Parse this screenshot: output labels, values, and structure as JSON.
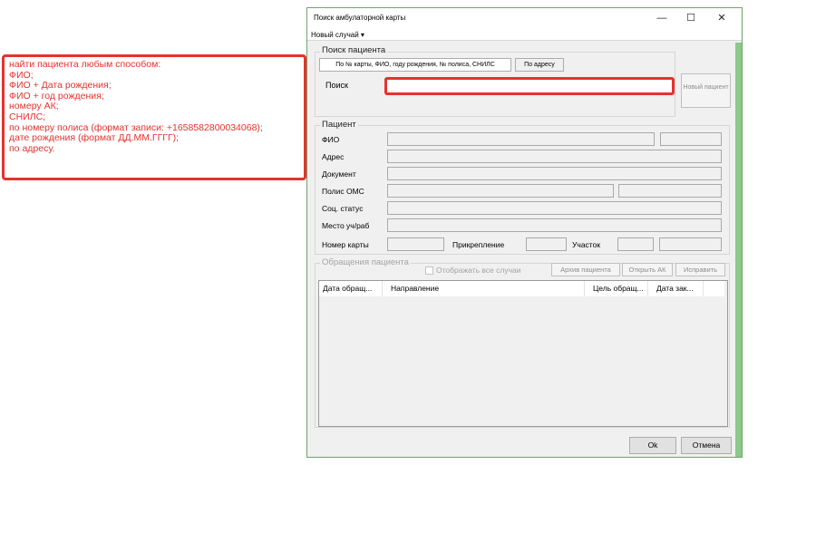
{
  "annotation": {
    "lines": [
      "найти пациента любым способом:",
      "ФИО;",
      "ФИО + Дата рождения;",
      "ФИО + год рождения;",
      "номеру АК;",
      "СНИЛС;",
      "по номеру полиса (формат записи: +1658582800034068);",
      "дате рождения (формат ДД.ММ.ГГГГ);",
      "по адресу."
    ],
    "color": "#e5322d"
  },
  "window": {
    "title": "Поиск амбулаторной карты",
    "controls": {
      "minimize": "—",
      "maximize": "☐",
      "close": "✕"
    },
    "menu": {
      "new_case": "Новый случай ▾"
    }
  },
  "search_group": {
    "label": "Поиск пациента",
    "tabs": [
      "По № карты, ФИО, году рождения, № полиса, СНИЛС",
      "По адресу"
    ],
    "search_label": "Поиск",
    "search_value": "",
    "new_patient_button": "Новый пациент"
  },
  "patient_group": {
    "label": "Пациент",
    "fields": {
      "fio": "ФИО",
      "address": "Адрес",
      "document": "Документ",
      "oms": "Полис ОМС",
      "social_status": "Соц. статус",
      "workplace": "Место уч/раб",
      "card_number": "Номер карты",
      "attachment": "Прикрепление",
      "district": "Участок"
    }
  },
  "visits_group": {
    "label": "Обращения пациента",
    "show_all_label": "Отображать все случаи",
    "buttons": {
      "archive": "Архив пациента",
      "open": "Открыть АК",
      "fix": "Исправить"
    },
    "columns": [
      "Дата обращ...",
      "Направление",
      "Цель обращ...",
      "Дата зак..."
    ]
  },
  "footer": {
    "ok": "Ok",
    "cancel": "Отмена"
  }
}
